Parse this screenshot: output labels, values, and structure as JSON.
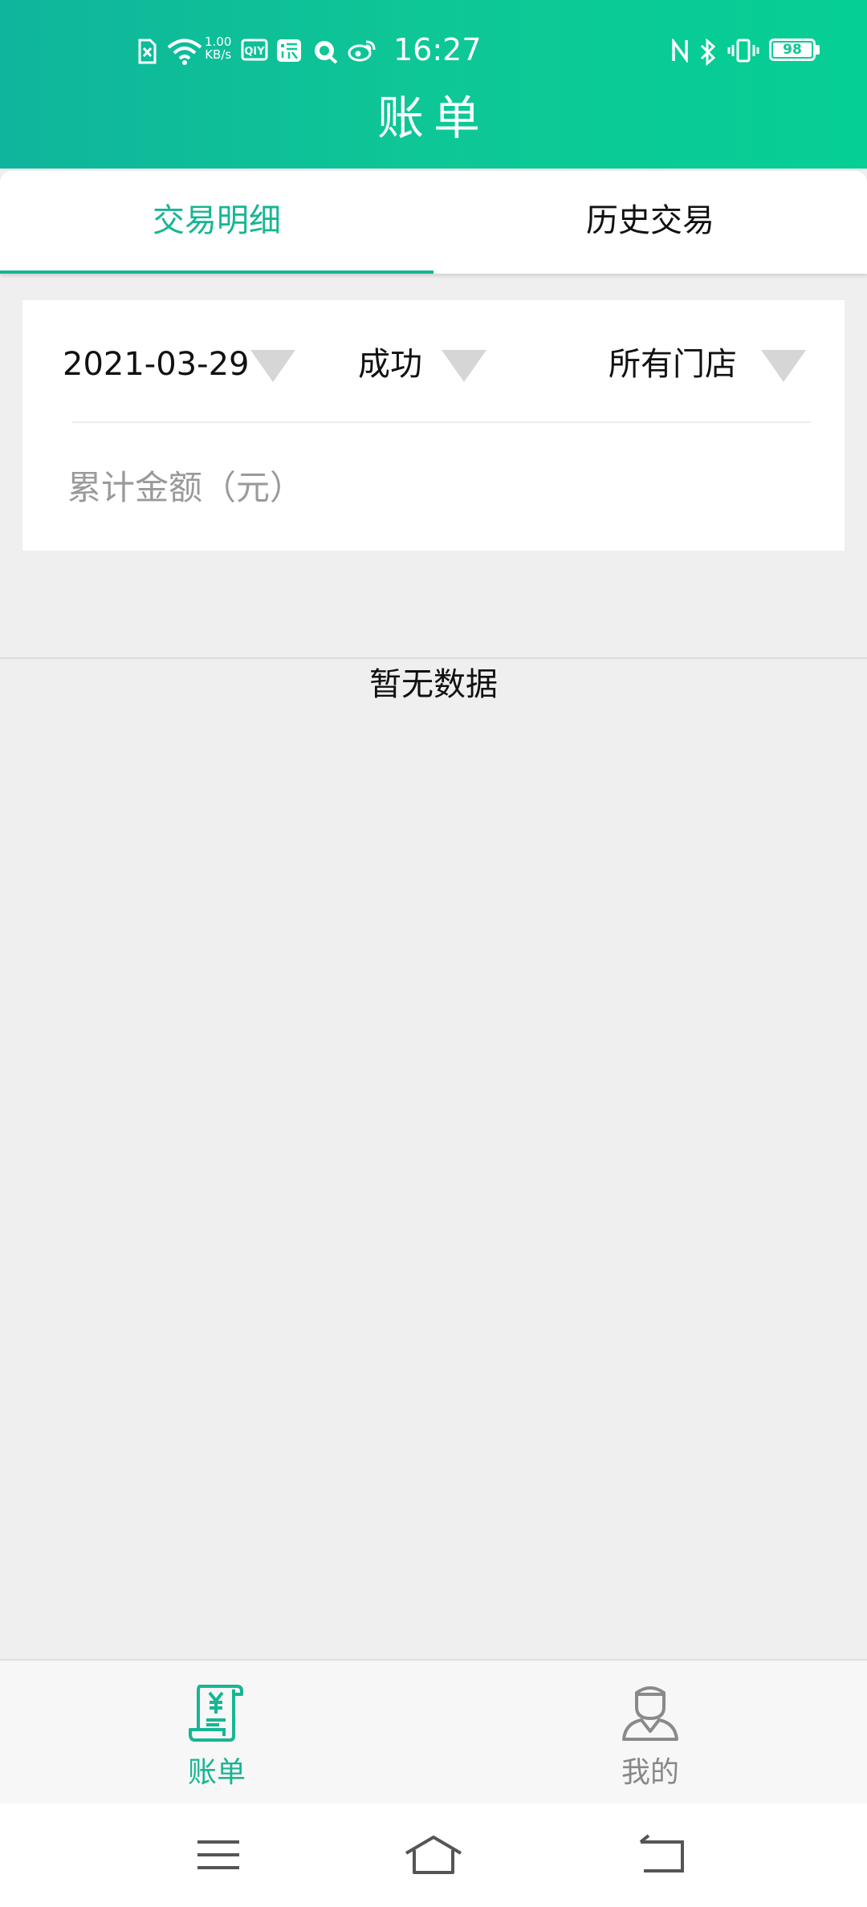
{
  "status_bar": {
    "time": "16:27",
    "net_speed_value": "1.00",
    "net_speed_unit": "KB/s",
    "battery": "98",
    "icons": [
      "sim-x-icon",
      "wifi-icon",
      "iqiyi-icon",
      "taobao-icon",
      "qq-browser-icon",
      "weibo-icon",
      "nfc-icon",
      "bluetooth-icon",
      "vibrate-icon",
      "battery-icon"
    ]
  },
  "header": {
    "title": "账单"
  },
  "tabs": [
    {
      "label": "交易明细",
      "active": true
    },
    {
      "label": "历史交易",
      "active": false
    }
  ],
  "filters": {
    "date": "2021-03-29",
    "status": "成功",
    "store": "所有门店"
  },
  "summary": {
    "total_label": "累计金额（元）"
  },
  "empty_state": {
    "text": "暂无数据"
  },
  "bottom_nav": [
    {
      "label": "账单",
      "icon": "bill-icon",
      "active": true
    },
    {
      "label": "我的",
      "icon": "profile-icon",
      "active": false
    }
  ],
  "system_nav": [
    "menu-icon",
    "home-icon",
    "back-icon"
  ],
  "colors": {
    "accent": "#17b692",
    "header": "#0ec796",
    "background": "#efefef"
  }
}
